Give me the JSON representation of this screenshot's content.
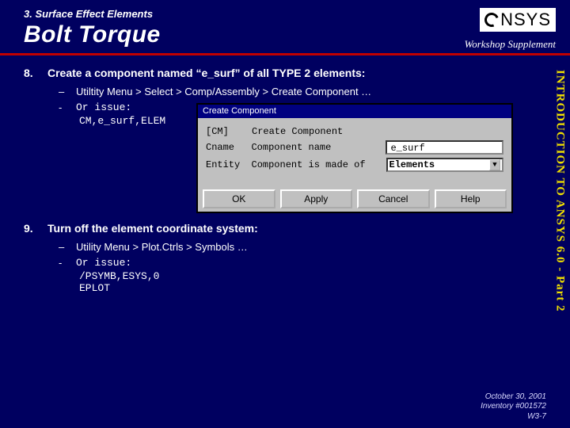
{
  "header": {
    "section": "3. Surface Effect Elements",
    "title": "Bolt Torque",
    "logo_text": "NSYS",
    "supplement": "Workshop Supplement"
  },
  "side_label": "INTRODUCTION TO ANSYS 6.0 - Part 2",
  "steps": [
    {
      "num": "8.",
      "text": "Create a component named “e_surf” of all TYPE 2 elements:",
      "subs": [
        {
          "dash": "–",
          "text": "Utiltity Menu > Select > Comp/Assembly > Create Component …"
        },
        {
          "dash": "-",
          "text": "Or issue:",
          "mono": true
        }
      ],
      "cmds": [
        "CM,e_surf,ELEM"
      ]
    },
    {
      "num": "9.",
      "text": "Turn off the element coordinate system:",
      "subs": [
        {
          "dash": "–",
          "text": "Utility Menu > Plot.Ctrls > Symbols …"
        },
        {
          "dash": "-",
          "text": "Or issue:",
          "mono": true
        }
      ],
      "cmds": [
        "/PSYMB,ESYS,0",
        "EPLOT"
      ]
    }
  ],
  "dialog": {
    "title_prefix": "Create Component",
    "line1_code": "[CM]",
    "line1_text": "Create Component",
    "line2_code": "Cname",
    "line2_text": "Component name",
    "input_value": "e_surf",
    "line3_code": "Entity",
    "line3_text": "Component is made of",
    "select_value": "Elements",
    "buttons": [
      "OK",
      "Apply",
      "Cancel",
      "Help"
    ]
  },
  "footer": {
    "date": "October 30, 2001",
    "inv": "Inventory #001572",
    "page": "W3-7"
  }
}
